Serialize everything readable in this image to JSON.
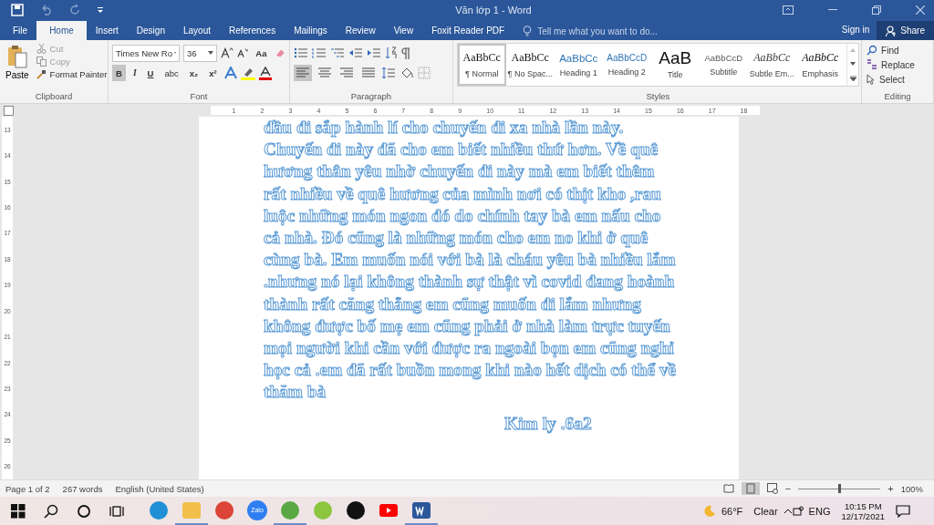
{
  "window": {
    "title": "Văn lớp 1 - Word"
  },
  "tabs": [
    {
      "label": "File",
      "selected": false
    },
    {
      "label": "Home",
      "selected": true
    },
    {
      "label": "Insert",
      "selected": false
    },
    {
      "label": "Design",
      "selected": false
    },
    {
      "label": "Layout",
      "selected": false
    },
    {
      "label": "References",
      "selected": false
    },
    {
      "label": "Mailings",
      "selected": false
    },
    {
      "label": "Review",
      "selected": false
    },
    {
      "label": "View",
      "selected": false
    },
    {
      "label": "Foxit Reader PDF",
      "selected": false
    }
  ],
  "tell_me": {
    "placeholder": "Tell me what you want to do..."
  },
  "account": {
    "sign_in": "Sign in",
    "share": "Share"
  },
  "clipboard": {
    "paste": "Paste",
    "cut": {
      "label": "Cut",
      "disabled": true
    },
    "copy": {
      "label": "Copy",
      "disabled": true
    },
    "format_painter": {
      "label": "Format Painter",
      "disabled": false
    },
    "label": "Clipboard"
  },
  "font": {
    "family": "Times New Ro",
    "size": "36",
    "change_case": "Aa",
    "label": "Font",
    "buttons": [
      {
        "text": "B",
        "kind": "bold",
        "selected": true
      },
      {
        "text": "I",
        "kind": "italic",
        "selected": false
      },
      {
        "text": "U",
        "kind": "underline",
        "selected": false
      },
      {
        "text": "abc",
        "kind": "strike",
        "selected": false
      },
      {
        "text": "x₂",
        "kind": "plain",
        "selected": false
      },
      {
        "text": "x²",
        "kind": "plain",
        "selected": false
      }
    ]
  },
  "paragraph": {
    "label": "Paragraph",
    "align": [
      {
        "selected": true
      },
      {
        "selected": false
      },
      {
        "selected": false
      },
      {
        "selected": false
      }
    ]
  },
  "styles": {
    "label": "Styles",
    "items": [
      {
        "preview": "AaBbCc",
        "name": "¶ Normal",
        "kind": "normal",
        "selected": true
      },
      {
        "preview": "AaBbCc",
        "name": "¶ No Spac...",
        "kind": "normal",
        "selected": false
      },
      {
        "preview": "AaBbCc",
        "name": "Heading 1",
        "kind": "heading",
        "selected": false
      },
      {
        "preview": "AaBbCcD",
        "name": "Heading 2",
        "kind": "heading2",
        "selected": false
      },
      {
        "preview": "AaB",
        "name": "Title",
        "kind": "title",
        "selected": false
      },
      {
        "preview": "AaBbCcD",
        "name": "Subtitle",
        "kind": "subtitle",
        "selected": false
      },
      {
        "preview": "AaBbCc",
        "name": "Subtle Em...",
        "kind": "subtle",
        "selected": false
      },
      {
        "preview": "AaBbCc",
        "name": "Emphasis",
        "kind": "emphasis",
        "selected": false
      }
    ]
  },
  "editing": {
    "label": "Editing",
    "find": "Find",
    "replace": "Replace",
    "select": "Select"
  },
  "ruler": {
    "ticks": [
      "1",
      "2",
      "3",
      "4",
      "5",
      "6",
      "7",
      "8",
      "9",
      "10",
      "11",
      "12",
      "13",
      "14",
      "15",
      "16",
      "17",
      "18"
    ],
    "vertical_ticks": [
      "13",
      "14",
      "15",
      "16",
      "17",
      "18",
      "19",
      "20",
      "21",
      "22",
      "23",
      "24",
      "25",
      "26"
    ]
  },
  "document": {
    "lines": [
      "đầu đi sắp hành lí cho chuyến đi xa nhà lần này.",
      "Chuyến đi này đã cho em biết nhiều thứ hơn. Về quê",
      "hương thân yêu nhờ chuyến đi này mà em biết thêm",
      "rất nhiều về quê hương của mình nơi có thịt kho ,rau",
      "luộc những món ngon đó do chính tay bà em nấu cho",
      "cả nhà. Đó cũng là những món cho em no khi ở quê",
      "cùng bà. Em muốn nói với bà là cháu yêu bà nhiều lắm",
      ".nhưng nó lại không thành sự thật vì covid đang hoành",
      "thành rất căng thẳng em cũng muốn đi lắm nhưng",
      "không được bố mẹ em cũng phải ở nhà làm trực tuyến",
      "mọi người khi cần với được ra ngoài bọn em cũng nghỉ",
      "học cả .em đã rất buồn mong khi nào hết dịch có thể về",
      "thăm bà"
    ],
    "signature": "Kim ly .6a2"
  },
  "status_bar": {
    "page": "Page 1 of 2",
    "words": "267 words",
    "language": "English (United States)",
    "zoom": "100%",
    "zoom_out": "−",
    "zoom_in": "+",
    "zoom_slider": {
      "level": 0.5
    }
  },
  "taskbar": {
    "apps": [
      {
        "kind": "edge",
        "running": false
      },
      {
        "kind": "folder",
        "running": true
      },
      {
        "kind": "chrome",
        "running": false
      },
      {
        "kind": "zalo",
        "label": "Zalo",
        "running": false
      },
      {
        "kind": "basket",
        "running": true
      },
      {
        "kind": "basket2",
        "running": false
      },
      {
        "kind": "tiktok",
        "running": false
      },
      {
        "kind": "youtube",
        "running": false
      },
      {
        "kind": "word",
        "running": true
      }
    ],
    "temperature": "66°F",
    "weather": "Clear",
    "language": "ENG",
    "time": "10:15 PM",
    "date": "12/17/2021"
  }
}
